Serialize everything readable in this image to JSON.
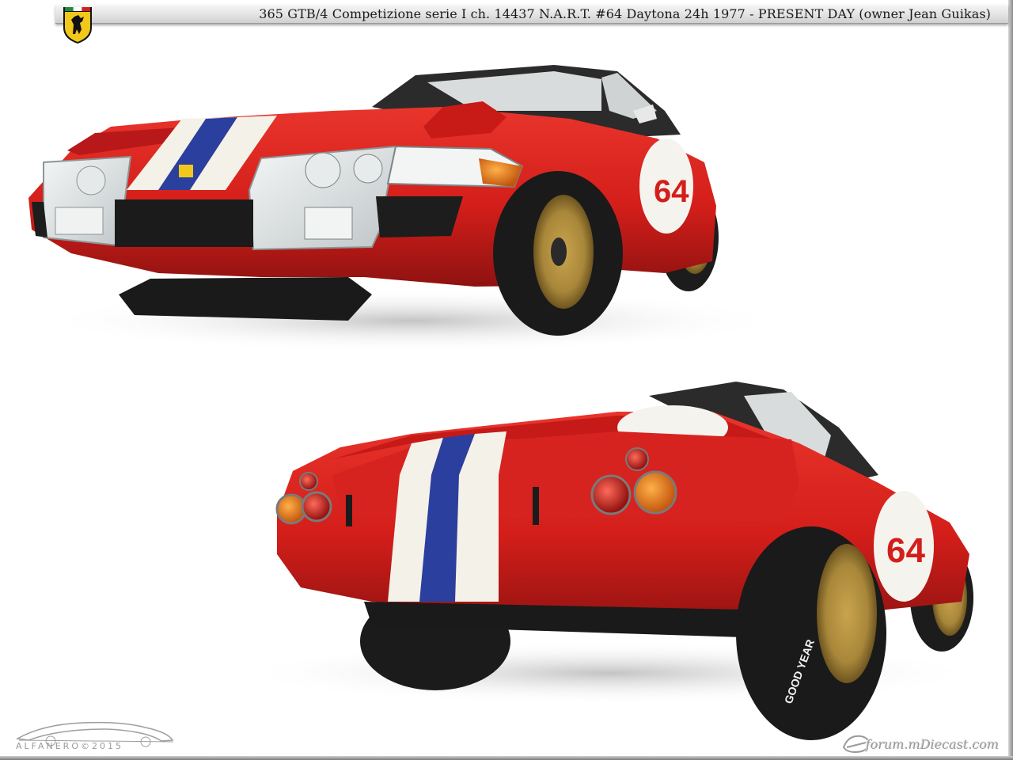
{
  "header": {
    "title": "365 GTB/4 Competizione serie I  ch. 14437 N.A.R.T.  #64  Daytona 24h 1977 - PRESENT DAY (owner Jean Guikas)"
  },
  "badge": {
    "icon": "prancing-horse-shield-icon"
  },
  "watermarks": {
    "left": "ALFANERO©2015",
    "right": "forum.mDiecast.com"
  },
  "photos": {
    "front": {
      "car_number": "64"
    },
    "rear": {
      "car_number": "64",
      "tyre_brand": "GOOD YEAR"
    }
  },
  "colors": {
    "body_red": "#d8201c",
    "stripe_white": "#f4f1e8",
    "stripe_blue": "#2a3f9e",
    "wheel_gold": "#a98a3a",
    "shield_yellow": "#f2c81a"
  }
}
